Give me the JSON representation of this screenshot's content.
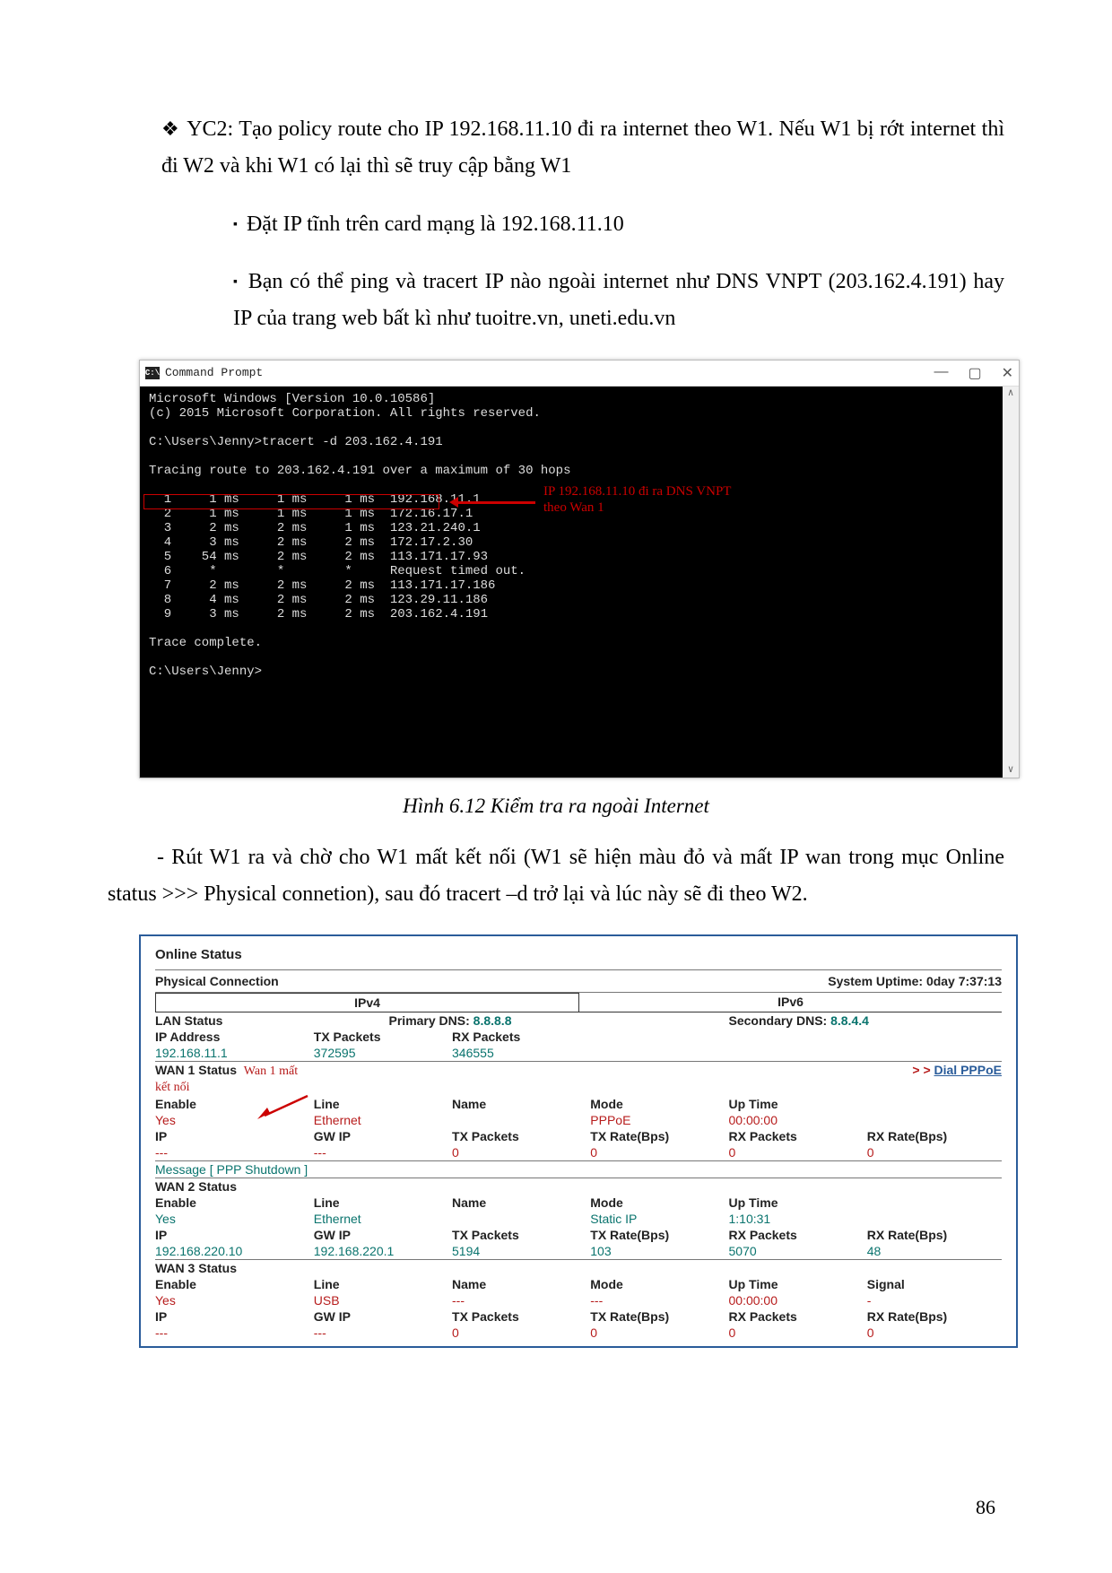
{
  "text": {
    "yc2": "YC2: Tạo policy route cho IP 192.168.11.10 đi ra internet theo W1. Nếu W1 bị rớt internet thì đi W2 và khi W1 có lại thì sẽ truy cập bằng W1",
    "sub1": "Đặt IP tĩnh trên card mạng là 192.168.11.10",
    "sub2": "Bạn có thể ping và tracert IP nào ngoài internet như DNS VNPT (203.162.4.191) hay IP của trang web bất kì như tuoitre.vn, uneti.edu.vn",
    "figcap": "Hình 6.12 Kiểm tra ra ngoài Internet",
    "para": "- Rút W1 ra và chờ cho W1 mất kết nối (W1 sẽ hiện màu đỏ và mất IP wan trong mục Online status >>> Physical connetion), sau đó tracert –d trở lại và lúc này sẽ đi theo W2.",
    "pagenum": "86"
  },
  "cmd": {
    "title": "Command Prompt",
    "line1": "Microsoft Windows [Version 10.0.10586]",
    "line2": "(c) 2015 Microsoft Corporation. All rights reserved.",
    "prompt1": "C:\\Users\\Jenny>tracert -d 203.162.4.191",
    "tracing": "Tracing route to 203.162.4.191 over a maximum of 30 hops",
    "row1": "  1     1 ms     1 ms     1 ms  192.168.11.1",
    "row2": "  2     1 ms     1 ms     1 ms  172.16.17.1",
    "row3": "  3     2 ms     2 ms     1 ms  123.21.240.1",
    "row4": "  4     3 ms     2 ms     2 ms  172.17.2.30",
    "row5": "  5    54 ms     2 ms     2 ms  113.171.17.93",
    "row6": "  6     *        *        *     Request timed out.",
    "row7": "  7     2 ms     2 ms     2 ms  113.171.17.186",
    "row8": "  8     4 ms     2 ms     2 ms  123.29.11.186",
    "row9": "  9     3 ms     2 ms     2 ms  203.162.4.191",
    "complete": "Trace complete.",
    "prompt2": "C:\\Users\\Jenny>",
    "note1": "IP 192.168.11.10 đi ra DNS VNPT",
    "note2": "theo Wan 1"
  },
  "panel": {
    "title": "Online Status",
    "phys": "Physical Connection",
    "uptime_label": "System Uptime: ",
    "uptime_value": "0day 7:37:13",
    "ipv4": "IPv4",
    "ipv6": "IPv6",
    "lan_status": "LAN Status",
    "primary_dns_label": "Primary DNS: ",
    "primary_dns": "8.8.8.8",
    "secondary_dns_label": "Secondary DNS: ",
    "secondary_dns": "8.8.4.4",
    "ip_address": "IP Address",
    "tx_packets": "TX Packets",
    "rx_packets": "RX Packets",
    "lan_ip": "192.168.11.1",
    "lan_tx": "372595",
    "lan_rx": "346555",
    "wan1_status": "WAN 1 Status",
    "wan1_note": "Wan 1 mất kết nối",
    "dial_pppoe": "Dial PPPoE",
    "lbl_enable": "Enable",
    "lbl_line": "Line",
    "lbl_name": "Name",
    "lbl_mode": "Mode",
    "lbl_uptime": "Up Time",
    "lbl_ip": "IP",
    "lbl_gwip": "GW IP",
    "lbl_txrate": "TX Rate(Bps)",
    "lbl_rxp": "RX Packets",
    "lbl_rxrate": "RX Rate(Bps)",
    "lbl_signal": "Signal",
    "yes": "Yes",
    "ethernet": "Ethernet",
    "usb": "USB",
    "pppoe": "PPPoE",
    "staticip": "Static IP",
    "zero_time": "00:00:00",
    "w1_msg": "Message [ PPP Shutdown ]",
    "dash": "---",
    "zero": "0",
    "dash1": "-",
    "wan2_status": "WAN 2 Status",
    "w2_uptime": "1:10:31",
    "w2_ip": "192.168.220.10",
    "w2_gw": "192.168.220.1",
    "w2_tx": "5194",
    "w2_txr": "103",
    "w2_rx": "5070",
    "w2_rxr": "48",
    "wan3_status": "WAN 3 Status",
    "gt": "> > "
  }
}
